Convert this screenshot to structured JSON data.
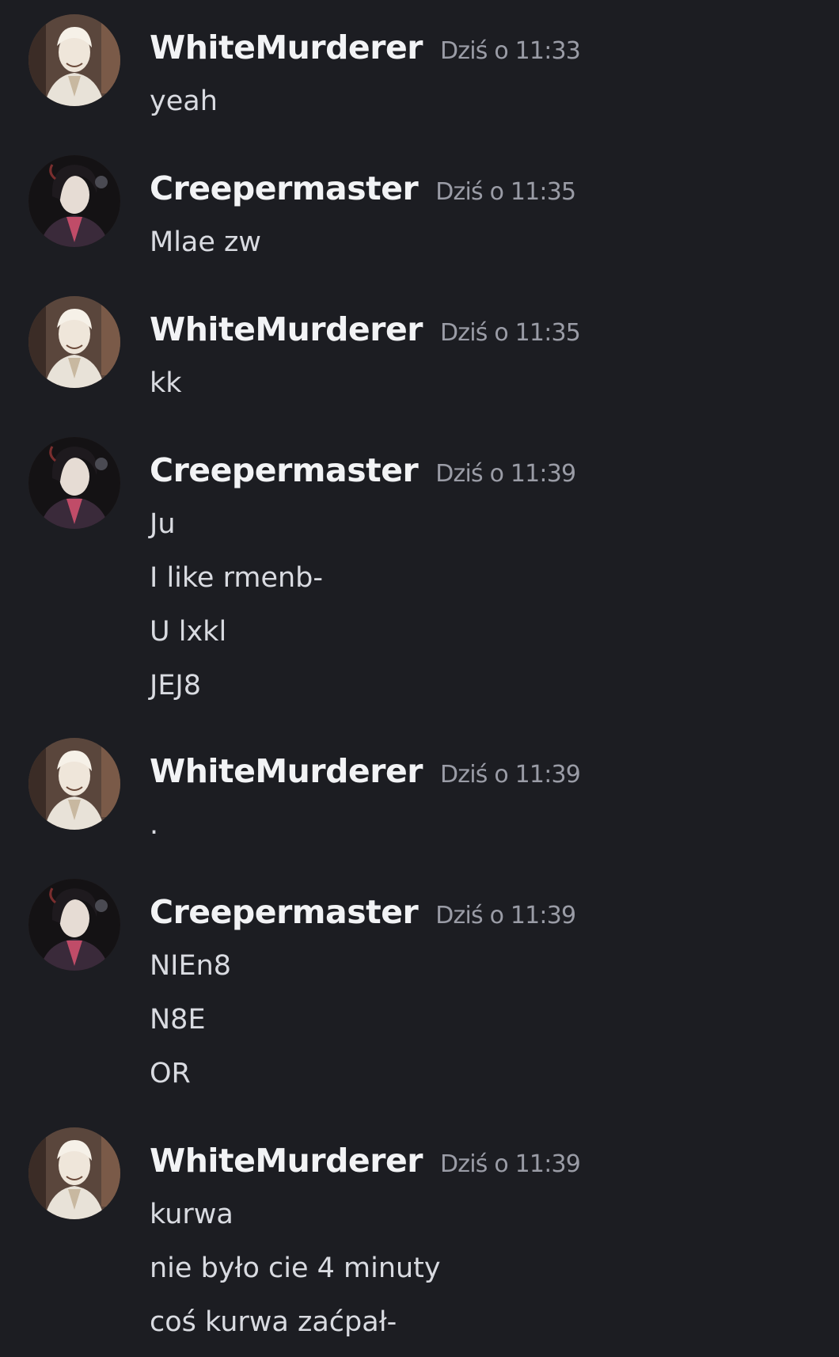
{
  "colors": {
    "background": "#1c1d22",
    "username": "#f2f3f5",
    "timestamp": "#9a9ca6",
    "message_text": "#d9dbe1"
  },
  "messages": [
    {
      "author": "WhiteMurderer",
      "timestamp": "Dziś o 11:33",
      "avatar": "white-murderer-avatar",
      "lines": [
        "yeah"
      ]
    },
    {
      "author": "Creepermaster",
      "timestamp": "Dziś o 11:35",
      "avatar": "creepermaster-avatar",
      "lines": [
        "Mlae zw"
      ]
    },
    {
      "author": "WhiteMurderer",
      "timestamp": "Dziś o 11:35",
      "avatar": "white-murderer-avatar",
      "lines": [
        "kk"
      ]
    },
    {
      "author": "Creepermaster",
      "timestamp": "Dziś o 11:39",
      "avatar": "creepermaster-avatar",
      "lines": [
        "Ju",
        "I like rmenb-",
        "U lxkl",
        "JEJ8"
      ]
    },
    {
      "author": "WhiteMurderer",
      "timestamp": "Dziś o 11:39",
      "avatar": "white-murderer-avatar",
      "lines": [
        "."
      ]
    },
    {
      "author": "Creepermaster",
      "timestamp": "Dziś o 11:39",
      "avatar": "creepermaster-avatar",
      "lines": [
        "NIEn8",
        "N8E",
        "OR"
      ]
    },
    {
      "author": "WhiteMurderer",
      "timestamp": "Dziś o 11:39",
      "avatar": "white-murderer-avatar",
      "lines": [
        "kurwa",
        "nie było cie 4 minuty",
        "coś kurwa zaćpał-"
      ]
    }
  ]
}
